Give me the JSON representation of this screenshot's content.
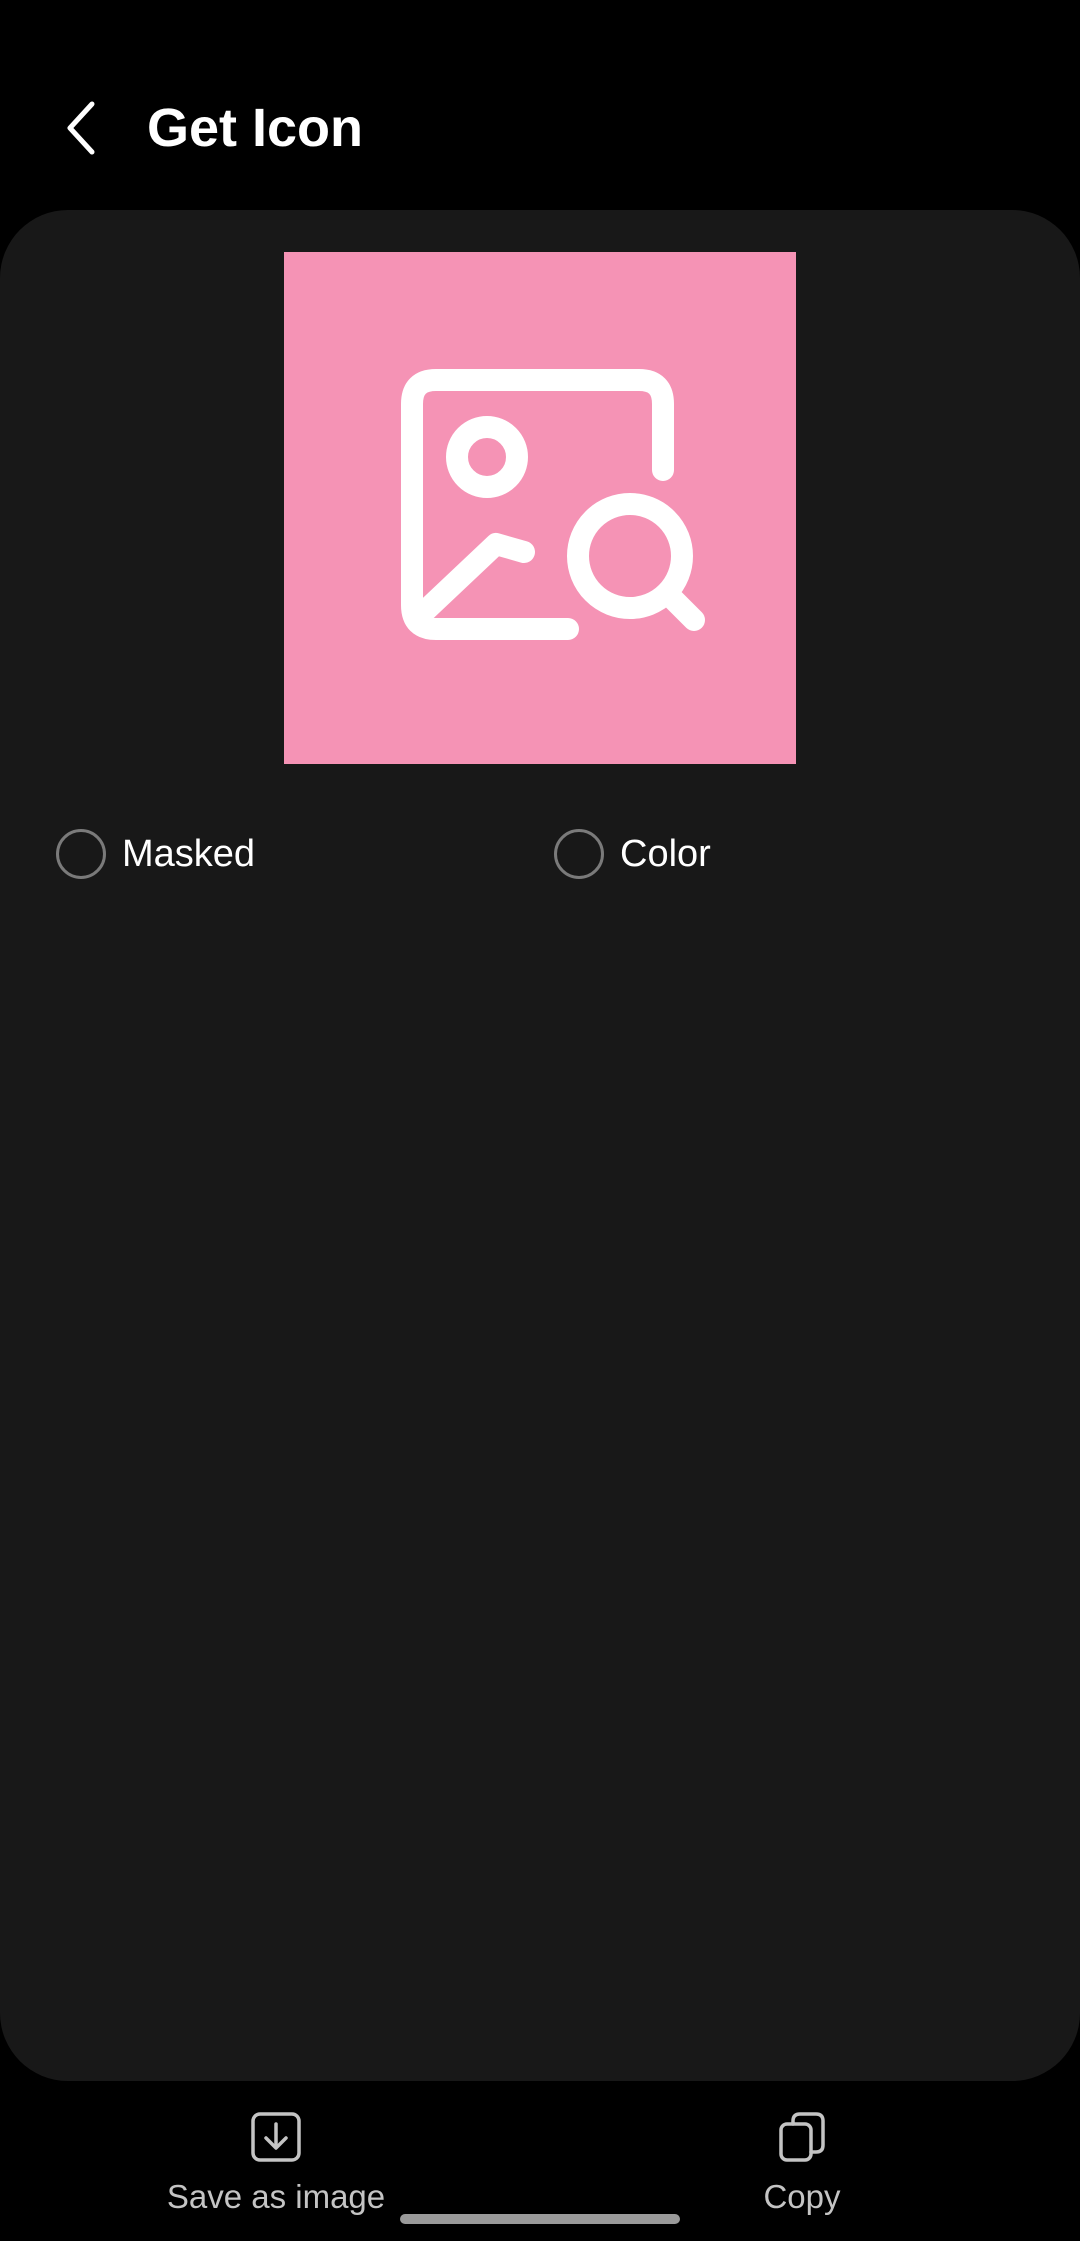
{
  "header": {
    "back_icon": "chevron-left-icon",
    "title": "Get Icon"
  },
  "preview": {
    "background_color": "#f593b5",
    "icon": "image-search-icon",
    "icon_color": "#ffffff"
  },
  "options": [
    {
      "label": "Masked",
      "selected": false
    },
    {
      "label": "Color",
      "selected": false
    }
  ],
  "bottom_bar": {
    "actions": [
      {
        "label": "Save as image",
        "icon": "download-icon"
      },
      {
        "label": "Copy",
        "icon": "copy-icon"
      }
    ]
  },
  "colors": {
    "background": "#000000",
    "card": "#181818",
    "label": "#c4c4c4",
    "radio_border": "#7a7a7a"
  }
}
